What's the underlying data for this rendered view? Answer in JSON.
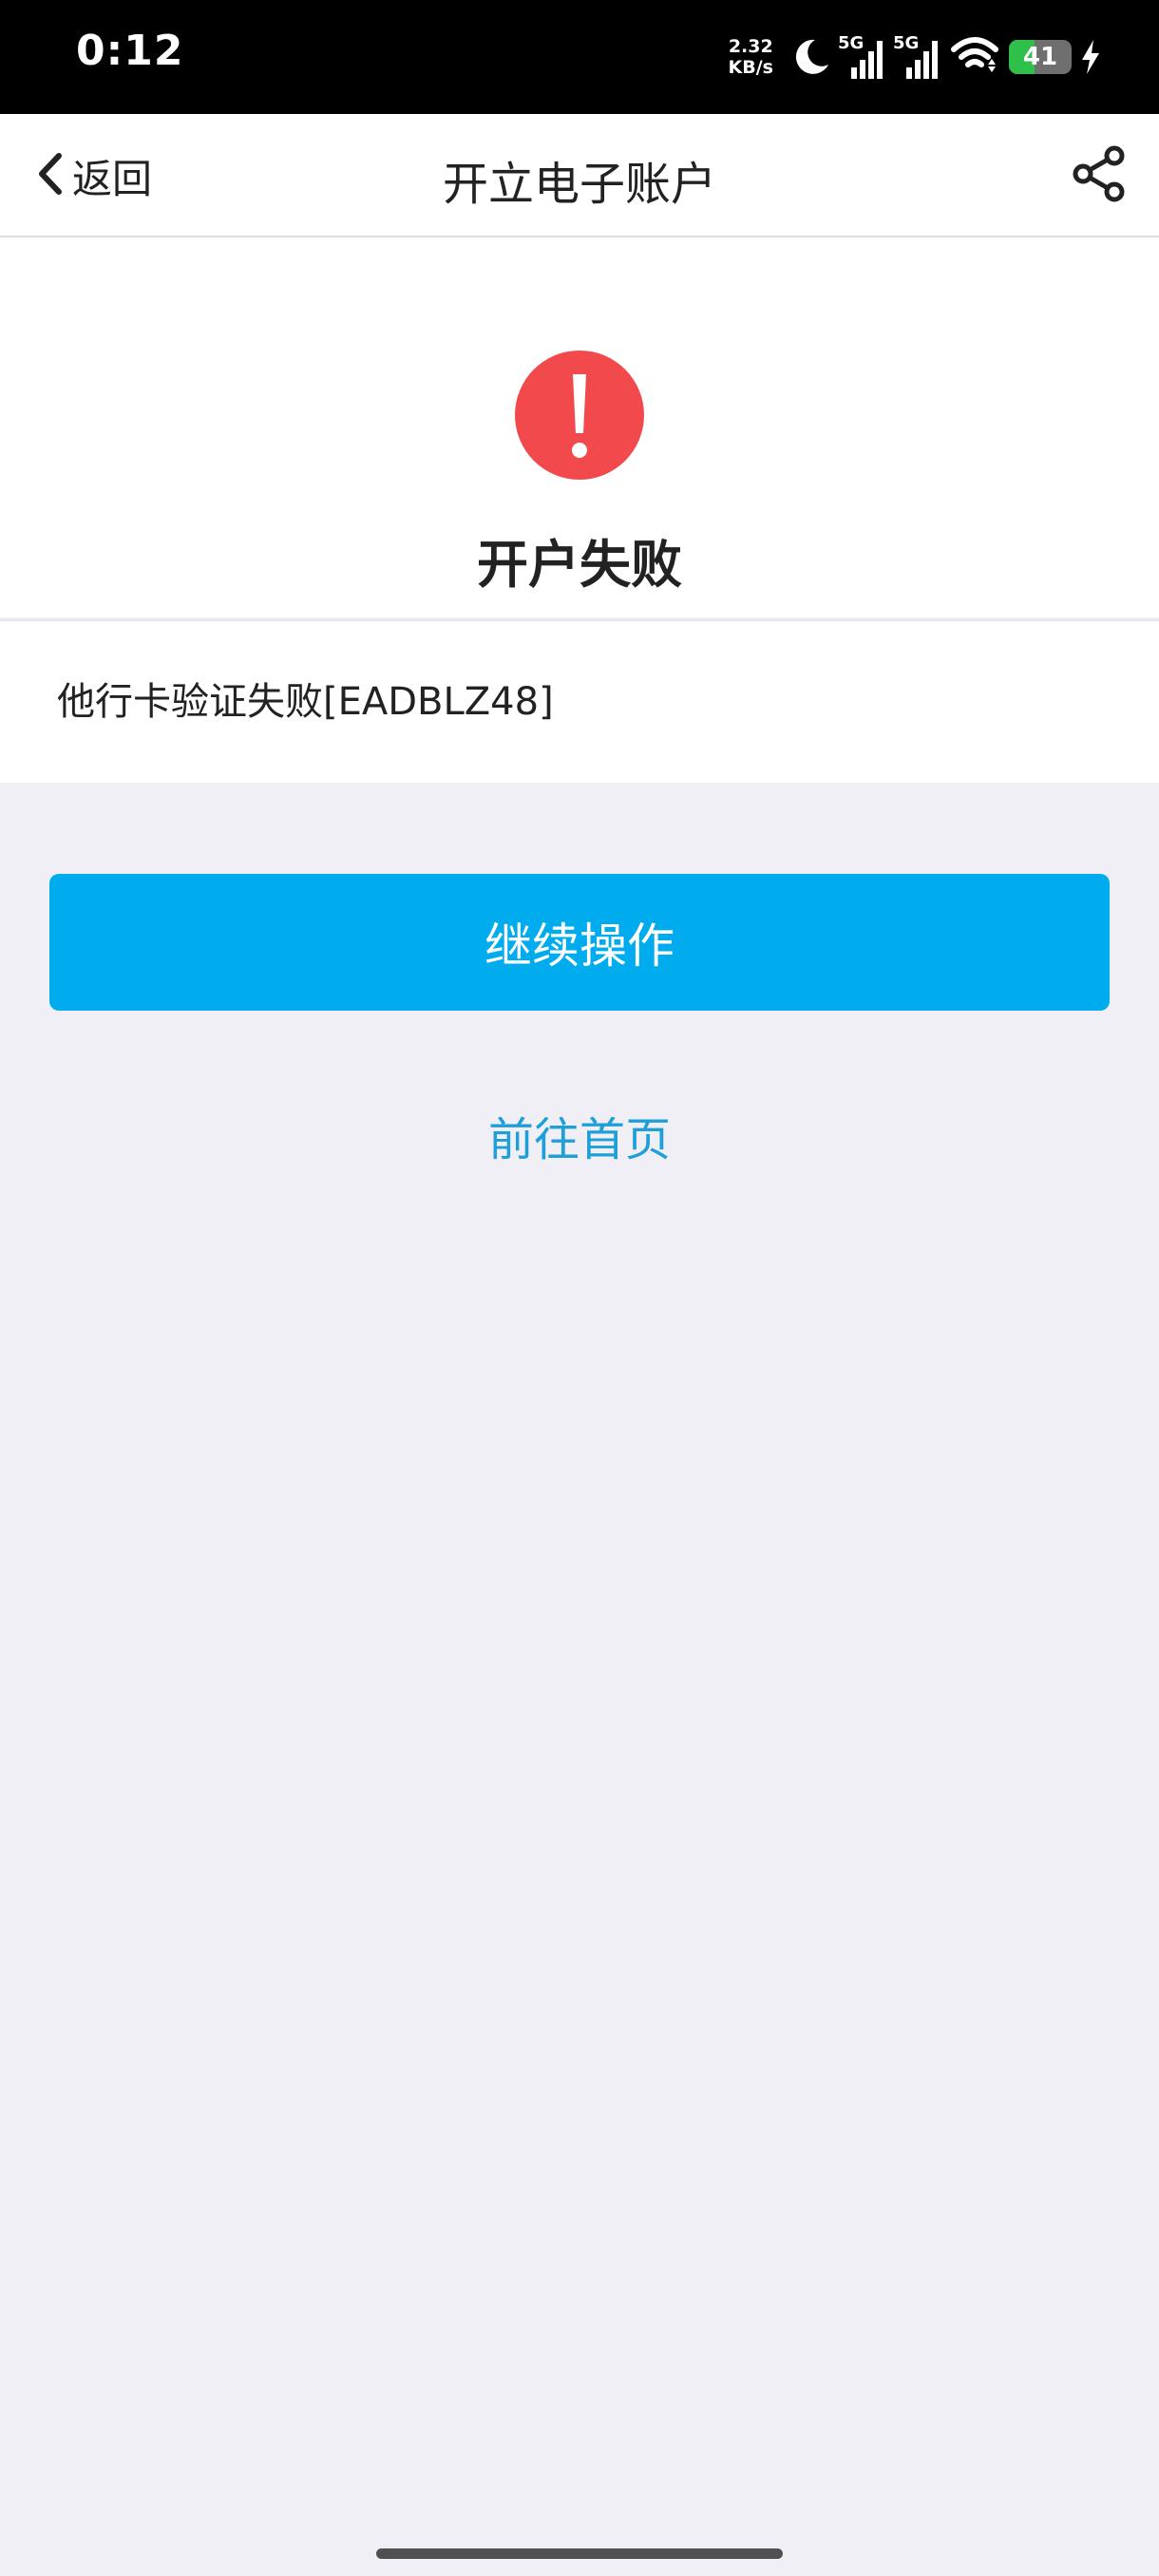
{
  "status_bar": {
    "time": "0:12",
    "net_speed_value": "2.32",
    "net_speed_unit": "KB/s",
    "signal_1_label": "5G",
    "signal_2_label": "5G",
    "battery_level": "41",
    "battery_fraction": 0.41,
    "icons": [
      "moon-icon",
      "signal-icon",
      "signal-icon",
      "wifi-icon",
      "battery-icon",
      "charging-bolt-icon"
    ]
  },
  "nav": {
    "back_label": "返回",
    "title": "开立电子账户",
    "back_icon": "chevron-left-icon",
    "share_icon": "share-icon"
  },
  "result": {
    "icon": "error-exclamation-icon",
    "icon_color": "#f2494c",
    "title": "开户失败",
    "message": "他行卡验证失败[EADBLZ48]"
  },
  "actions": {
    "continue_label": "继续操作",
    "continue_color": "#00abee",
    "home_label": "前往首页",
    "home_color": "#1e9fd8"
  },
  "colors": {
    "page_background": "#efeff5",
    "status_bar_background": "#000000",
    "battery_fill": "#2ec04a"
  }
}
